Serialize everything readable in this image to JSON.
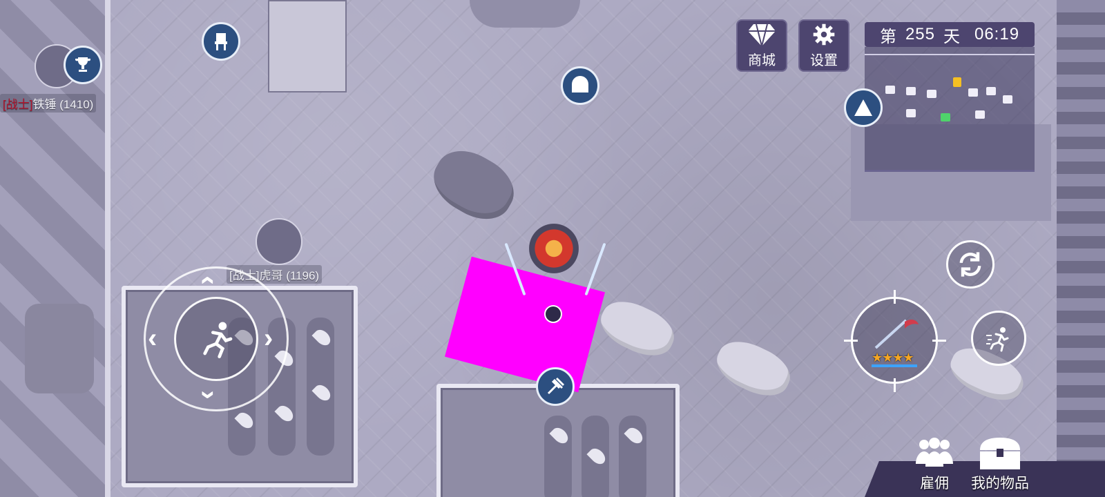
{
  "hud": {
    "shop": {
      "label": "商城",
      "icon": "diamond-icon"
    },
    "settings": {
      "label": "设置",
      "icon": "gear-icon"
    },
    "day": {
      "prefix": "第",
      "number": "255",
      "suffix": "天",
      "time": "06:19"
    }
  },
  "players": [
    {
      "class": "[战士]",
      "name": "铁锤",
      "level": "(1410)",
      "icon": "trophy-icon"
    },
    {
      "class": "[战士]",
      "name": "虎哥",
      "level": "(1196)"
    }
  ],
  "map_icons": [
    "chair-icon",
    "furnace-icon",
    "pitchfork-icon",
    "tent-icon",
    "skull-icon"
  ],
  "controls": {
    "movement": "run-icon",
    "refresh": "refresh-icon",
    "sprint": "sprint-icon",
    "weapon": {
      "name": "scythe-icon",
      "stars": "★★★★"
    }
  },
  "bottom_menu": {
    "hire": "雇佣",
    "inventory": "我的物品"
  },
  "colors": {
    "panel": "#4d456f",
    "icon_blue": "#2c4f80",
    "warrior_tag": "#b3122b",
    "star": "#f5a623"
  }
}
